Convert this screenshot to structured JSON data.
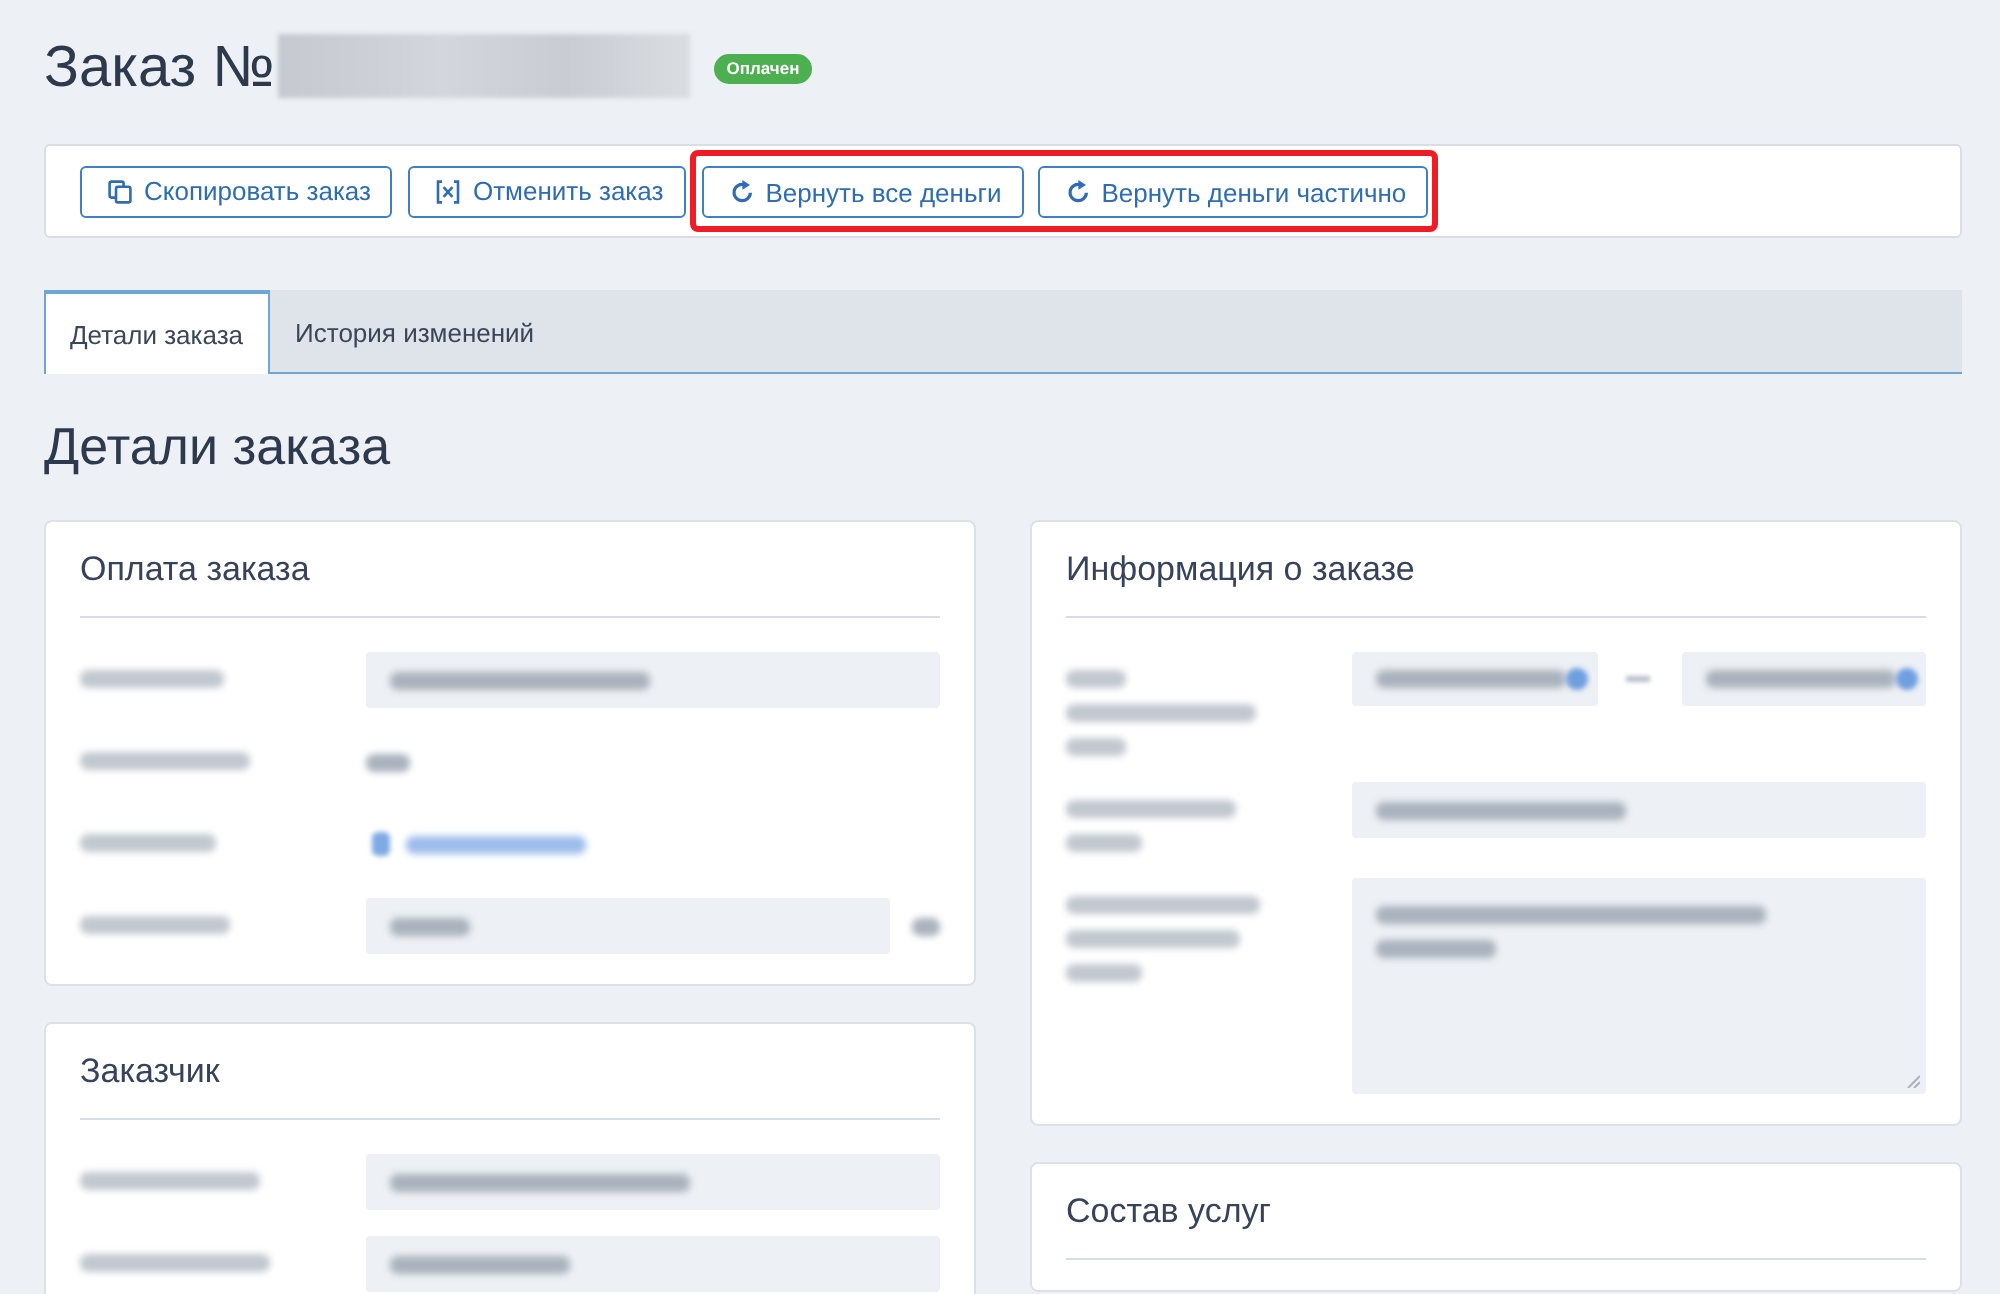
{
  "header": {
    "title": "Заказ №",
    "number_redacted": true,
    "status": "Оплачен"
  },
  "actions": [
    {
      "label": "Скопировать заказ",
      "kind": "copy",
      "highlighted": false
    },
    {
      "label": "Отменить заказ",
      "kind": "cancel",
      "highlighted": false
    },
    {
      "label": "Вернуть все деньги",
      "kind": "refund",
      "highlighted": true
    },
    {
      "label": "Вернуть деньги частично",
      "kind": "refund",
      "highlighted": true
    }
  ],
  "tabs": [
    {
      "label": "Детали заказа",
      "selected": true
    },
    {
      "label": "История изменений",
      "selected": false
    }
  ],
  "section_title": "Детали заказа",
  "columns": [
    {
      "cards": [
        {
          "title": "Оплата заказа",
          "rows": [
            {
              "kind": "field"
            },
            {
              "kind": "text"
            },
            {
              "kind": "link"
            },
            {
              "kind": "amount"
            }
          ]
        },
        {
          "title": "Заказчик",
          "rows": [
            {
              "kind": "field"
            },
            {
              "kind": "field"
            }
          ]
        }
      ]
    },
    {
      "cards": [
        {
          "title": "Информация о заказе",
          "rows": [
            {
              "kind": "date_range"
            },
            {
              "kind": "field"
            },
            {
              "kind": "textarea"
            }
          ]
        },
        {
          "title": "Состав услуг"
        }
      ]
    }
  ]
}
